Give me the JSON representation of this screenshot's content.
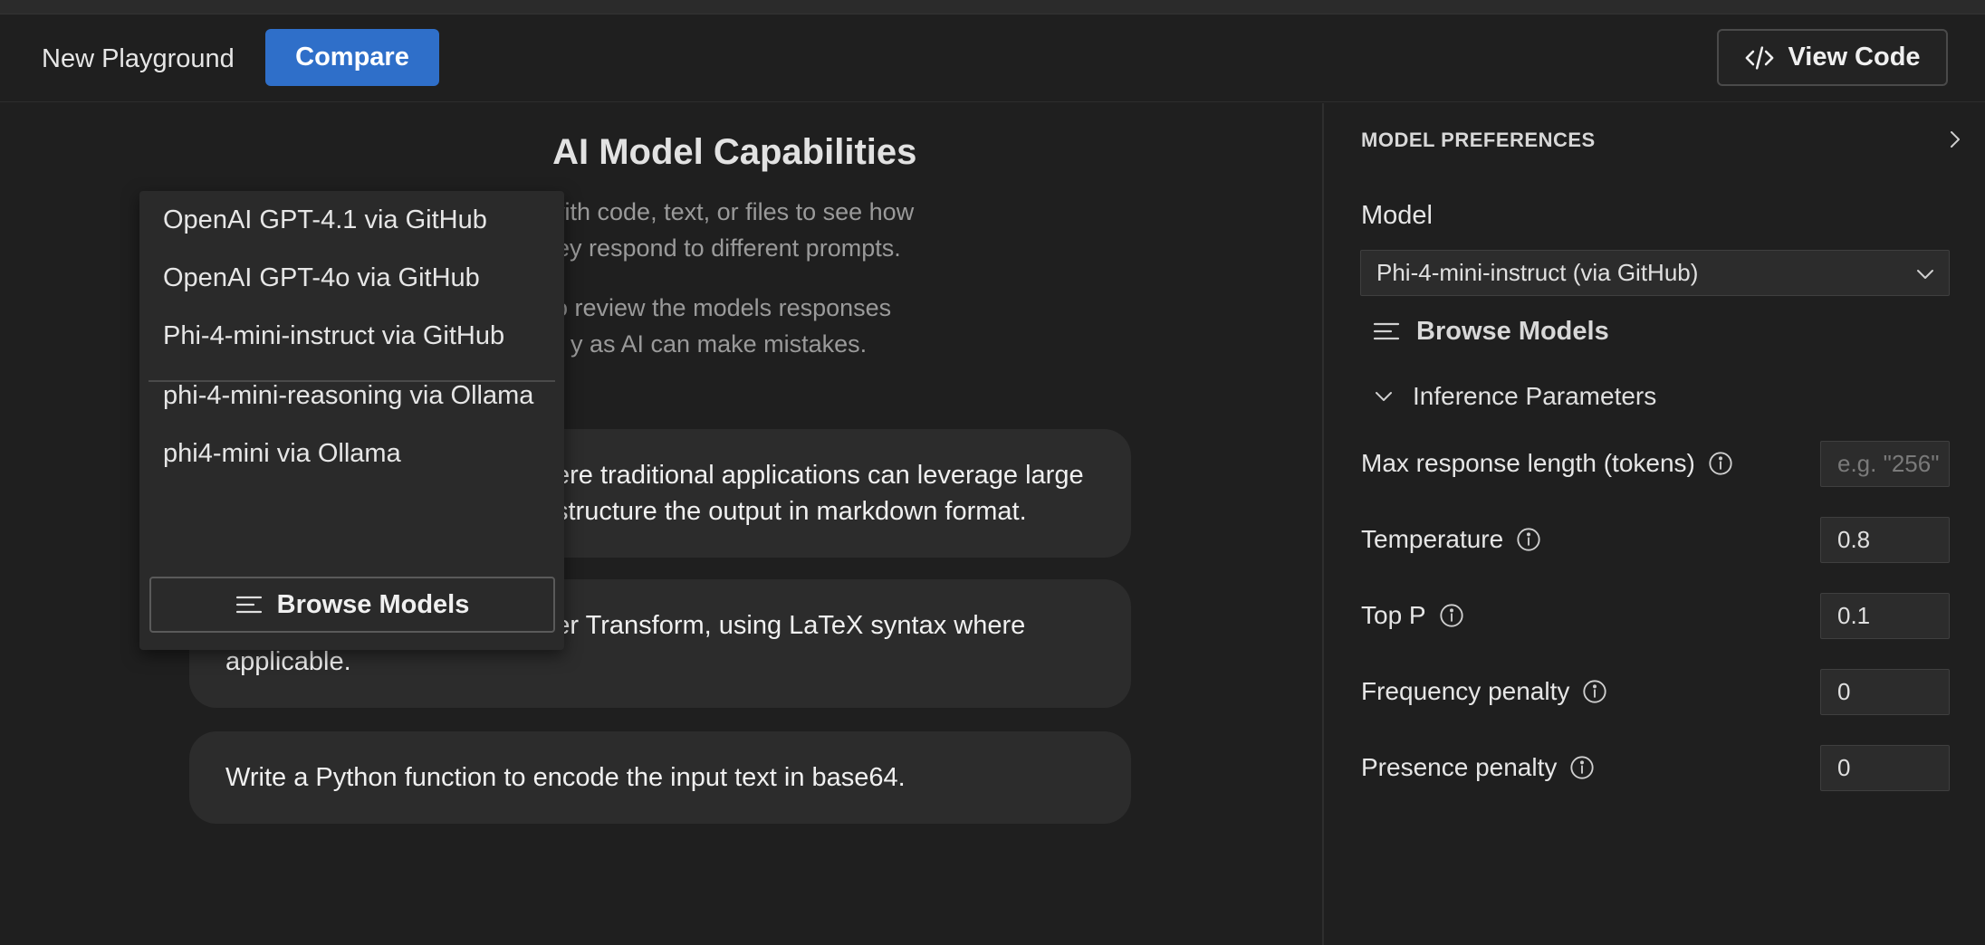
{
  "header": {
    "title": "New Playground",
    "compare_label": "Compare",
    "view_code_label": "View Code"
  },
  "main": {
    "heading": "AI Model Capabilities",
    "description_1": "with code, text, or files to see how\n   ey respond to different prompts.",
    "description_1a": "with code, text, or files to see how",
    "description_1b": "ey respond to different prompts.",
    "description_2a": "o review the models responses",
    "description_2b": "y as AI can make mistakes.",
    "prompt_cards": [
      {
        "line1": "ere traditional applications can leverage large",
        "line2": "structure the output in markdown format."
      },
      {
        "line1": "Explain the formula for Fourier Transform, using LaTeX syntax where",
        "line2": "applicable."
      },
      {
        "line1": "Write a Python function to encode the input text in base64.",
        "line2": ""
      }
    ]
  },
  "compare_dropdown": {
    "items": [
      "OpenAI GPT-4.1 via GitHub",
      "OpenAI GPT-4o via GitHub",
      "Phi-4-mini-instruct via GitHub",
      "phi-4-mini-reasoning via Ollama",
      "phi4-mini via Ollama"
    ],
    "browse_label": "Browse Models"
  },
  "preferences": {
    "title": "MODEL PREFERENCES",
    "model_label": "Model",
    "model_value": "Phi-4-mini-instruct (via GitHub)",
    "browse_label": "Browse Models",
    "inference_label": "Inference Parameters",
    "params": [
      {
        "label": "Max response length (tokens)",
        "value": "",
        "placeholder": "e.g. \"256\""
      },
      {
        "label": "Temperature",
        "value": "0.8"
      },
      {
        "label": "Top P",
        "value": "0.1"
      },
      {
        "label": "Frequency penalty",
        "value": "0"
      },
      {
        "label": "Presence penalty",
        "value": "0"
      }
    ]
  },
  "colors": {
    "background": "#1f1f1f",
    "accent": "#2f6fc9",
    "card": "#2c2c2c"
  }
}
